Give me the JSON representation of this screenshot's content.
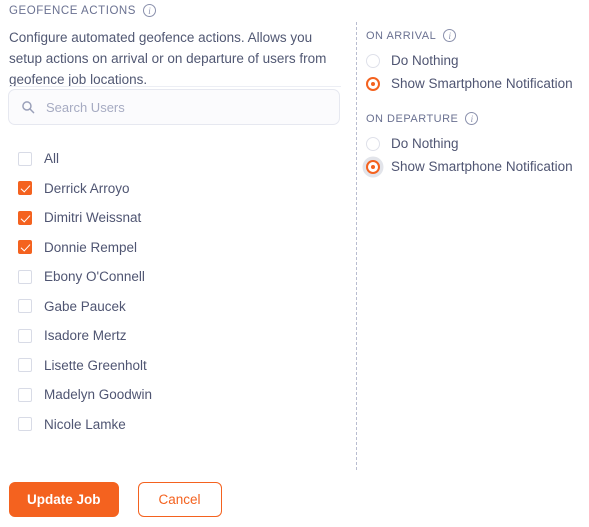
{
  "header": {
    "title": "GEOFENCE ACTIONS",
    "info_icon": "info-icon",
    "description": "Configure automated geofence actions. Allows you setup actions on arrival or on departure of users from geofence job locations."
  },
  "search": {
    "icon": "search-icon",
    "placeholder": "Search Users",
    "value": ""
  },
  "users": [
    {
      "label": "All",
      "checked": false
    },
    {
      "label": "Derrick Arroyo",
      "checked": true
    },
    {
      "label": "Dimitri Weissnat",
      "checked": true
    },
    {
      "label": "Donnie Rempel",
      "checked": true
    },
    {
      "label": "Ebony O'Connell",
      "checked": false
    },
    {
      "label": "Gabe Paucek",
      "checked": false
    },
    {
      "label": "Isadore Mertz",
      "checked": false
    },
    {
      "label": "Lisette Greenholt",
      "checked": false
    },
    {
      "label": "Madelyn Goodwin",
      "checked": false
    },
    {
      "label": "Nicole Lamke",
      "checked": false
    }
  ],
  "arrival": {
    "label": "ON ARRIVAL",
    "info_icon": "info-icon",
    "options": [
      {
        "label": "Do Nothing",
        "selected": false,
        "focused": false
      },
      {
        "label": "Show Smartphone Notification",
        "selected": true,
        "focused": false
      }
    ]
  },
  "departure": {
    "label": "ON DEPARTURE",
    "info_icon": "info-icon",
    "options": [
      {
        "label": "Do Nothing",
        "selected": false,
        "focused": false
      },
      {
        "label": "Show Smartphone Notification",
        "selected": true,
        "focused": true
      }
    ]
  },
  "footer": {
    "primary_label": "Update Job",
    "secondary_label": "Cancel"
  },
  "colors": {
    "accent": "#f4621f",
    "text": "#4f5572",
    "muted": "#6a7191",
    "border": "#e6e8f0"
  }
}
